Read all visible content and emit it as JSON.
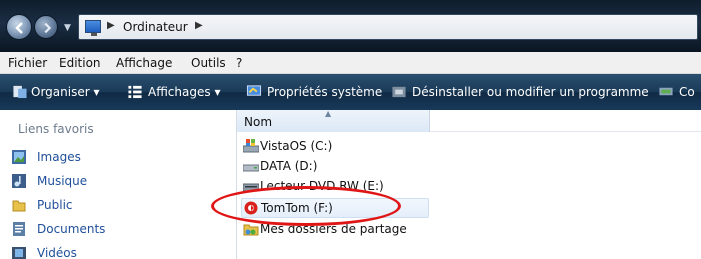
{
  "address": {
    "crumb": "Ordinateur"
  },
  "menu": [
    "Fichier",
    "Edition",
    "Affichage",
    "Outils",
    "?"
  ],
  "toolbar": {
    "organize": "Organiser",
    "views": "Affichages",
    "system_props": "Propriétés système",
    "uninstall": "Désinstaller ou modifier un programme",
    "cut_label": "Co"
  },
  "leftnav": {
    "title": "Liens favoris",
    "items": [
      "Images",
      "Musique",
      "Public",
      "Documents",
      "Vidéos"
    ]
  },
  "content": {
    "column": "Nom",
    "rows": [
      {
        "label": "VistaOS (C:)",
        "icon": "windows-drive-icon"
      },
      {
        "label": "DATA (D:)",
        "icon": "drive-icon"
      },
      {
        "label": "Lecteur DVD RW (E:)",
        "icon": "dvd-drive-icon"
      },
      {
        "label": "TomTom (F:)",
        "icon": "tomtom-drive-icon",
        "selected": true
      },
      {
        "label": "Mes dossiers de partage",
        "icon": "shared-folder-icon"
      }
    ]
  },
  "colors": {
    "annotation": "#e01616",
    "toolbar": "#1a3a57",
    "link": "#1f4f9a"
  }
}
